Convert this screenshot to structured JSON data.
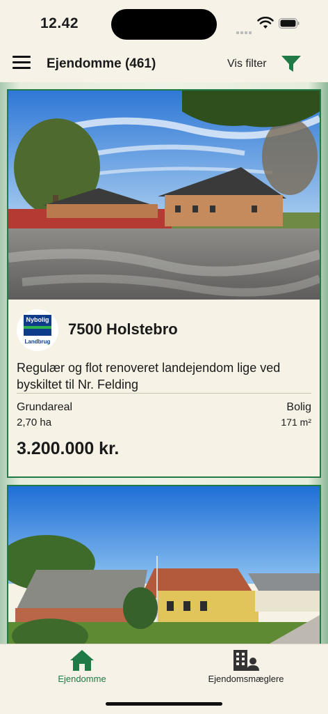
{
  "status": {
    "time": "12.42"
  },
  "header": {
    "title": "Ejendomme (461)",
    "filter_label": "Vis filter"
  },
  "listings": [
    {
      "city": "7500 Holstebro",
      "description": "Regulær og flot renoveret landejendom lige ved byskiltet til Nr. Felding",
      "broker_logo_text": "Nybolig",
      "broker_logo_sub": "Landbrug",
      "plot_label": "Grundareal",
      "plot_value": "2,70 ha",
      "living_label": "Bolig",
      "living_value": "171 m²",
      "price": "3.200.000 kr."
    },
    {}
  ],
  "tabbar": {
    "tabs": [
      {
        "label": "Ejendomme",
        "icon": "home-icon",
        "active": true
      },
      {
        "label": "Ejendomsmæglere",
        "icon": "agents-icon",
        "active": false
      }
    ]
  },
  "colors": {
    "accent": "#1f7a46",
    "background": "#f5f1e6",
    "broker_blue": "#0f3c8a"
  }
}
